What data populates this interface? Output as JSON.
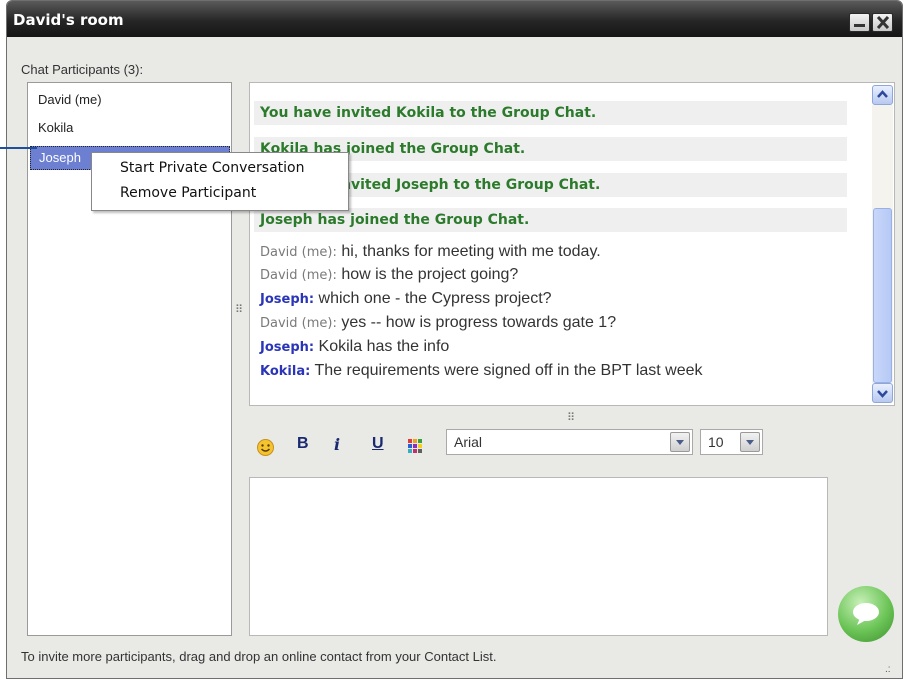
{
  "window": {
    "title": "David's room"
  },
  "participants": {
    "label": "Chat Participants (3):",
    "items": [
      "David (me)",
      "Kokila",
      "Joseph"
    ],
    "selected": "Joseph"
  },
  "context_menu": {
    "items": [
      "Start Private Conversation",
      "Remove Participant"
    ]
  },
  "chat": {
    "system_messages": [
      "You have invited Kokila to the Group Chat.",
      "Kokila has joined the Group Chat.",
      "You have invited Joseph to the Group Chat.",
      "Joseph has joined the Group Chat."
    ],
    "messages": [
      {
        "sender": "David (me):",
        "text": "hi, thanks for meeting with me today."
      },
      {
        "sender": "David (me):",
        "text": "how is the project going?"
      },
      {
        "sender": "Joseph:",
        "text": "which one - the Cypress project?"
      },
      {
        "sender": "David (me):",
        "text": "yes -- how is progress towards gate 1?"
      },
      {
        "sender": "Joseph:",
        "text": "Kokila has the info"
      },
      {
        "sender": "Kokila:",
        "text": "The requirements were signed off in the BPT last week"
      }
    ]
  },
  "toolbar": {
    "bold": "B",
    "italic": "i",
    "underline": "U",
    "font": "Arial",
    "size": "10"
  },
  "footer": "To invite more participants, drag and drop an online contact from your Contact List.",
  "colors": {
    "system_text": "#2c7a2c",
    "sender_blue": "#2a35b8",
    "selection": "#6c7fd1",
    "send_button": "#6bc456"
  }
}
